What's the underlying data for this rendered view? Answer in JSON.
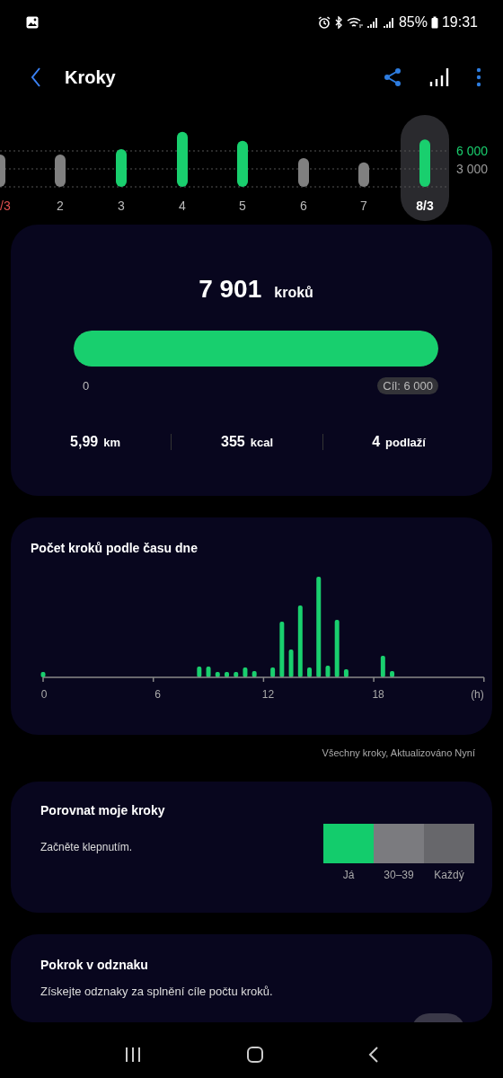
{
  "status_bar": {
    "battery": "85%",
    "time": "19:31"
  },
  "app_bar": {
    "title": "Kroky"
  },
  "week": {
    "days": [
      {
        "selected": false,
        "weekend": true
      },
      {
        "selected": false,
        "weekend": false
      },
      {
        "selected": false,
        "weekend": false
      },
      {
        "selected": false,
        "weekend": false
      },
      {
        "selected": false,
        "weekend": false
      },
      {
        "selected": false,
        "weekend": false
      },
      {
        "selected": false,
        "weekend": false
      },
      {
        "selected": true,
        "weekend": false
      }
    ],
    "chart_data": {
      "type": "bar",
      "categories": [
        "/3",
        "2",
        "3",
        "4",
        "5",
        "6",
        "7",
        "8/3"
      ],
      "stacked": true,
      "series": [
        {
          "color": "#19cf6e",
          "values": [
            null,
            null,
            6300,
            9200,
            7700,
            null,
            null,
            7900
          ]
        },
        {
          "color": "#808080",
          "values": [
            5400,
            5400,
            null,
            null,
            null,
            4800,
            4100,
            null
          ]
        }
      ],
      "ylim": [
        0,
        9600
      ],
      "yticks": [
        {
          "value": 3000,
          "label": "3 000"
        },
        {
          "value": 6000,
          "label": "6 000"
        }
      ]
    }
  },
  "summary": {
    "steps": "7 901",
    "unit": "kroků",
    "level": 1,
    "start": "0",
    "goal": "Cíl: 6 000",
    "stats": [
      {
        "value": "5,99",
        "unit": "km"
      },
      {
        "value": "355",
        "unit": "kcal"
      },
      {
        "value": "4",
        "unit": "podlaží"
      }
    ]
  },
  "hourly": {
    "title": "Počet kroků podle času dne",
    "axis_labels": [
      "0",
      "6",
      "12",
      "18",
      "(h)"
    ],
    "note": "Všechny kroky, Aktualizováno Nyní"
  },
  "compare": {
    "title": "Porovnat moje kroky",
    "hint": "Začněte klepnutím.",
    "groups": [
      {
        "label": "Já",
        "color": "#13cc6c"
      },
      {
        "label": "30–39",
        "color": "#7b7b7f"
      },
      {
        "label": "Každý",
        "color": "#67676b"
      }
    ]
  },
  "badges": {
    "title": "Pokrok v odznaku",
    "text": "Získejte odznaky za splnění cíle počtu kroků."
  }
}
